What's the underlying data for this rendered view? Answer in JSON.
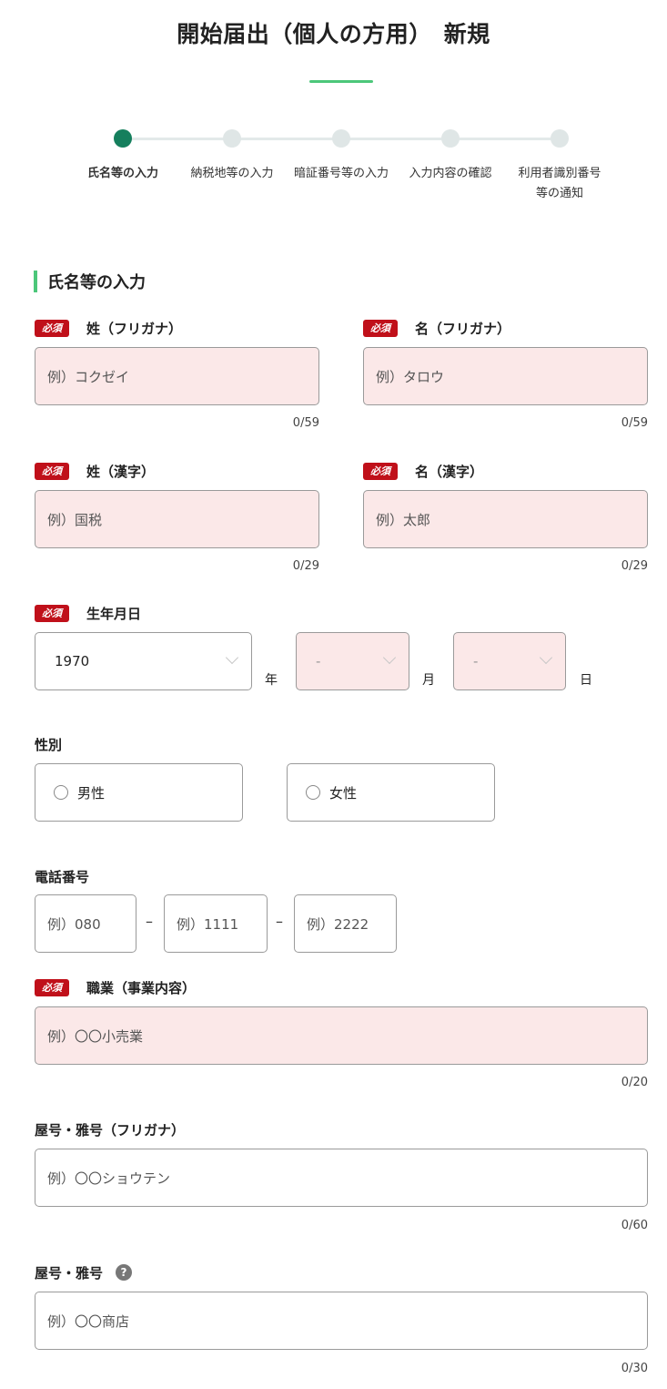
{
  "page": {
    "title": "開始届出（個人の方用）　新規"
  },
  "steps": [
    {
      "label": "氏名等の入力",
      "active": true
    },
    {
      "label": "納税地等の入力",
      "active": false
    },
    {
      "label": "暗証番号等の入力",
      "active": false
    },
    {
      "label": "入力内容の確認",
      "active": false
    },
    {
      "label": "利用者識別番号\n等の通知",
      "active": false
    }
  ],
  "section": {
    "title": "氏名等の入力"
  },
  "required_badge": "必須",
  "fields": {
    "sei_kana": {
      "label": "姓（フリガナ）",
      "placeholder": "例）コクゼイ",
      "counter": "0/59"
    },
    "mei_kana": {
      "label": "名（フリガナ）",
      "placeholder": "例）タロウ",
      "counter": "0/59"
    },
    "sei_kanji": {
      "label": "姓（漢字）",
      "placeholder": "例）国税",
      "counter": "0/29"
    },
    "mei_kanji": {
      "label": "名（漢字）",
      "placeholder": "例）太郎",
      "counter": "0/29"
    },
    "birthdate": {
      "label": "生年月日",
      "year": "1970",
      "year_unit": "年",
      "month": "-",
      "month_unit": "月",
      "day": "-",
      "day_unit": "日"
    },
    "gender": {
      "label": "性別",
      "male": "男性",
      "female": "女性"
    },
    "phone": {
      "label": "電話番号",
      "p1": "例）080",
      "p2": "例）1111",
      "p3": "例）2222",
      "sep": "–"
    },
    "occupation": {
      "label": "職業（事業内容）",
      "placeholder": "例）〇〇小売業",
      "counter": "0/20"
    },
    "yago_kana": {
      "label": "屋号・雅号（フリガナ）",
      "placeholder": "例）〇〇ショウテン",
      "counter": "0/60"
    },
    "yago": {
      "label": "屋号・雅号",
      "placeholder": "例）〇〇商店",
      "counter": "0/30",
      "help": "?"
    }
  },
  "colors": {
    "accent_green": "#4cc77a",
    "step_active": "#157f5d",
    "required_red": "#c0101a",
    "required_field_bg": "#fbe8e8"
  }
}
